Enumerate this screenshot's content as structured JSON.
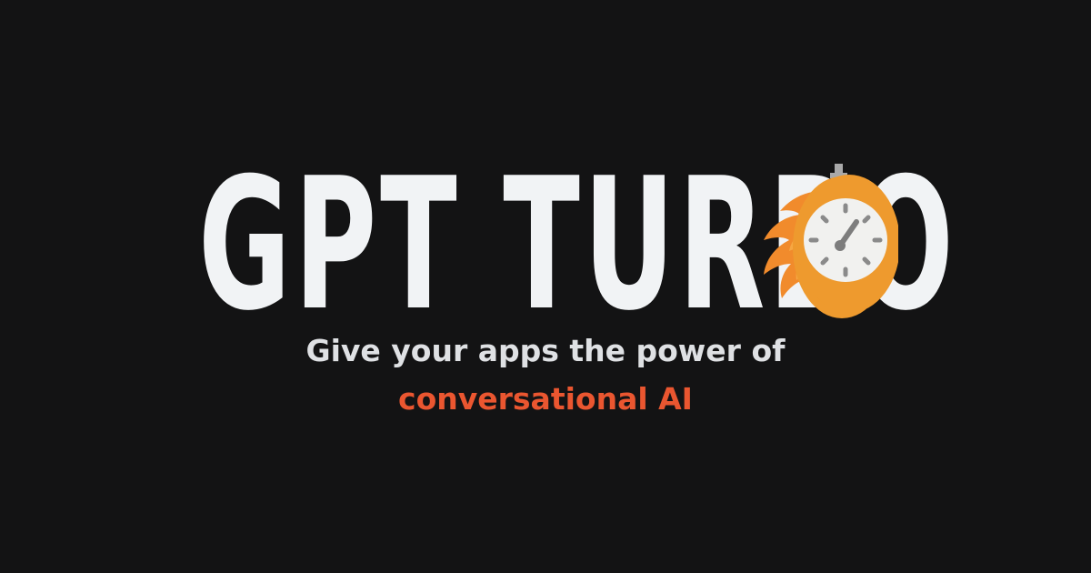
{
  "brand": {
    "name": "GPT TURBO",
    "icon": "stopwatch-on-fire-icon"
  },
  "tagline": {
    "line1": "Give your apps the power of",
    "line2": "conversational AI"
  },
  "colors": {
    "background": "#131314",
    "logo_text": "#f1f3f5",
    "tagline_primary": "#dfe1e4",
    "tagline_accent": "#ea5630",
    "flame_orange": "#f18b2c",
    "stopwatch_body": "#ee9a2e",
    "dial_face": "#f1f1ef",
    "dial_marks": "#8a8a8a"
  }
}
